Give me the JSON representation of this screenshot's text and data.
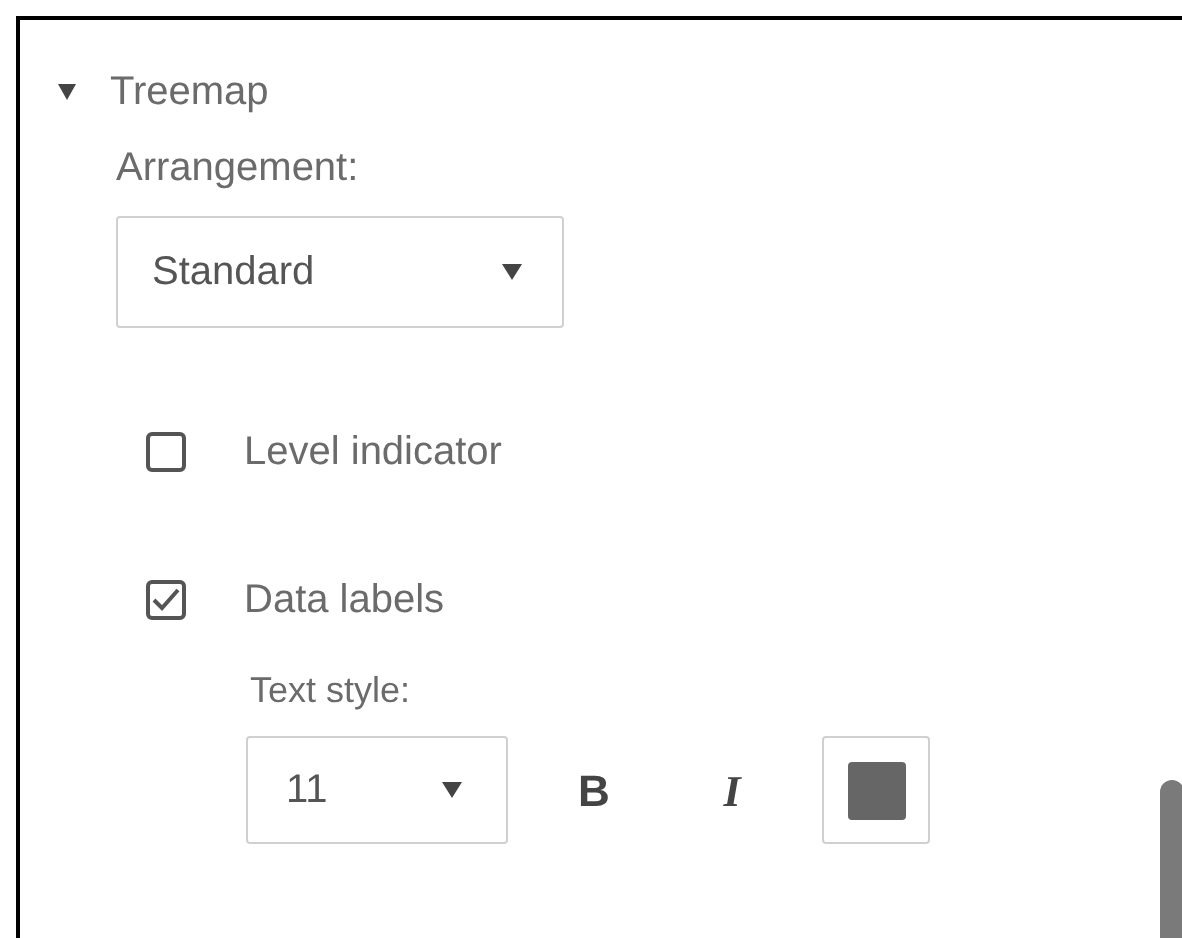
{
  "section": {
    "title": "Treemap",
    "expanded": true
  },
  "arrangement": {
    "label": "Arrangement:",
    "value": "Standard"
  },
  "options": [
    {
      "label": "Level indicator",
      "checked": false
    },
    {
      "label": "Data labels",
      "checked": true
    }
  ],
  "text_style": {
    "label": "Text style:",
    "size": "11",
    "bold": "B",
    "italic": "I",
    "color": "#666666"
  }
}
